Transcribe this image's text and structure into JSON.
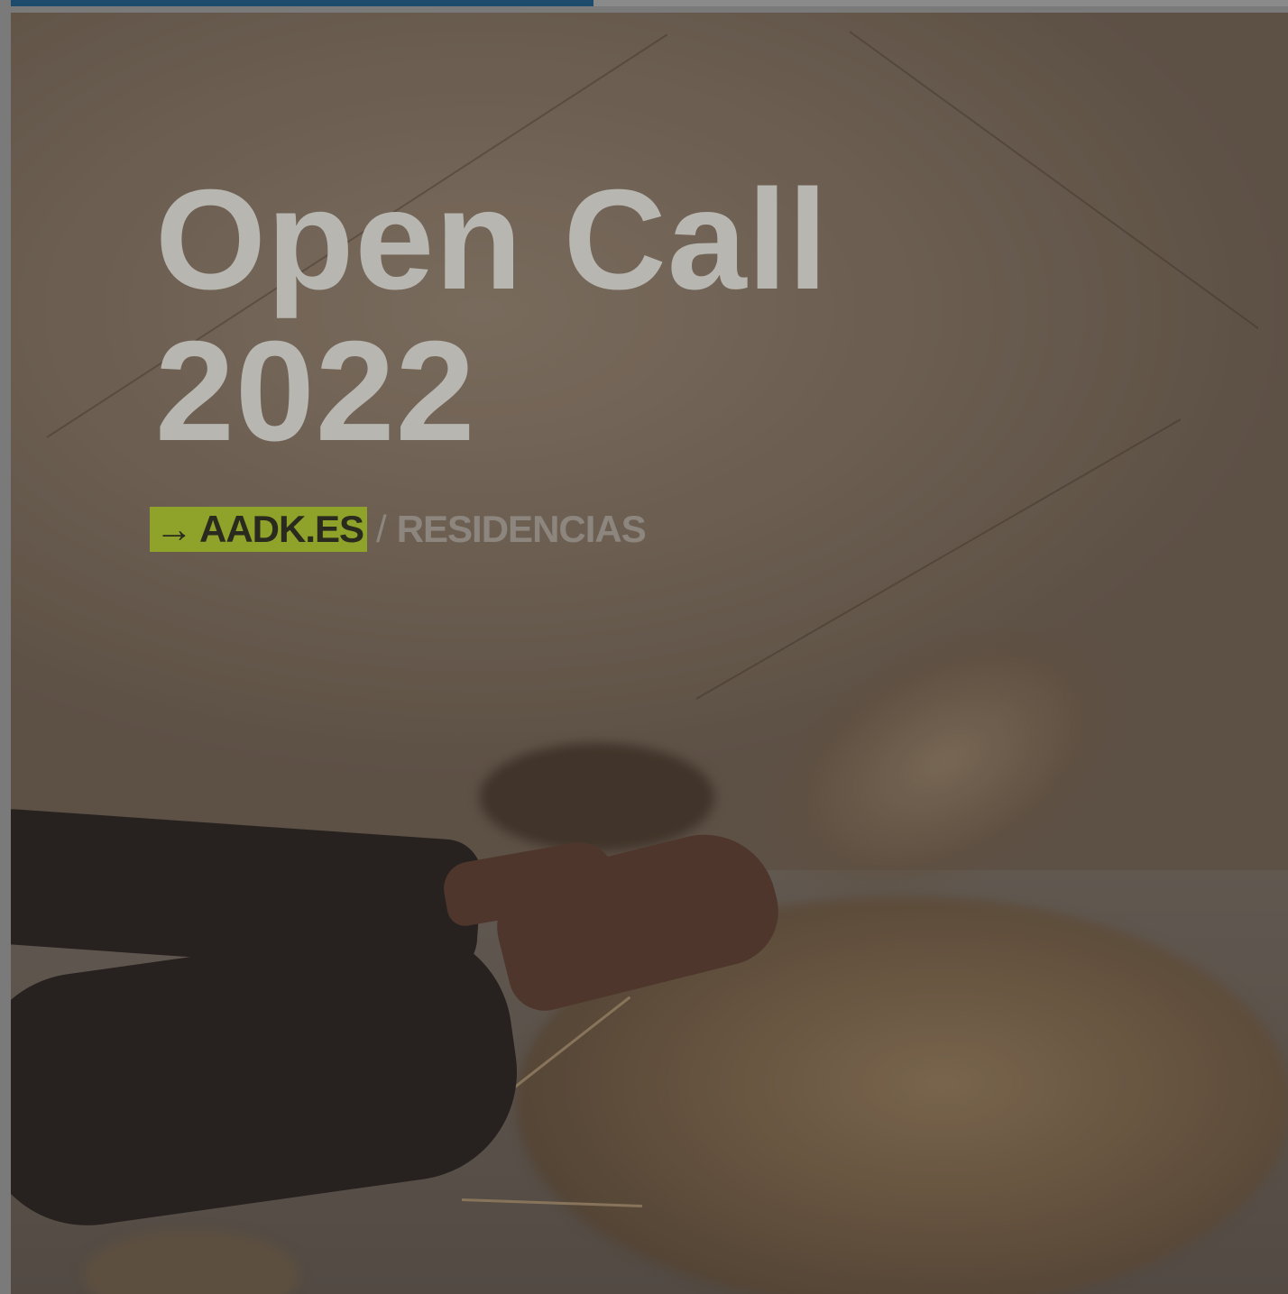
{
  "progress": {
    "fraction": 0.456,
    "color": "#1d4b6b"
  },
  "post": {
    "title_line1": "Open Call",
    "title_line2": "2022",
    "link_arrow": "→",
    "link_domain": "AADK.ES",
    "link_separator": "/",
    "link_section": "RESIDENCIAS",
    "accent_color": "#8fa32a"
  }
}
